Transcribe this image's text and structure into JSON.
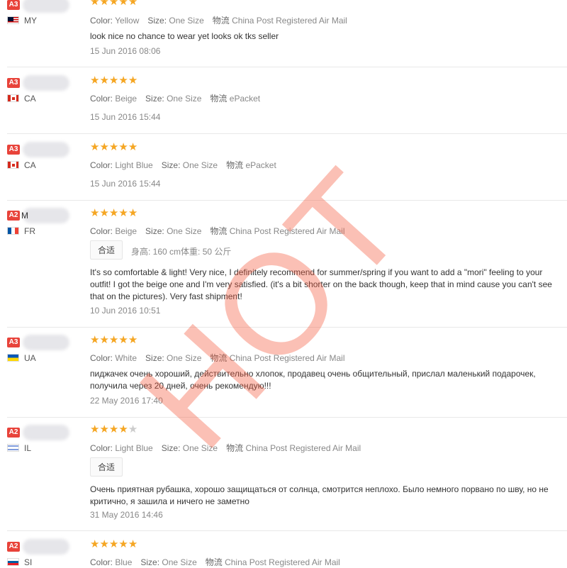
{
  "labels": {
    "color": "Color:",
    "size": "Size:",
    "shipping": "物流",
    "fit": "合适",
    "height": "身高:",
    "weight": "体重:"
  },
  "reviews": [
    {
      "level": "A3",
      "name": "",
      "country_code": "MY",
      "rating": 5,
      "color": "Yellow",
      "size": "One Size",
      "shipping": "China Post Registered Air Mail",
      "text": [
        "look nice no chance to wear yet looks ok tks seller"
      ],
      "date": "15 Jun 2016 08:06"
    },
    {
      "level": "A3",
      "name": "",
      "country_code": "CA",
      "rating": 5,
      "color": "Beige",
      "size": "One Size",
      "shipping": "ePacket",
      "text": [],
      "date": "15 Jun 2016 15:44"
    },
    {
      "level": "A3",
      "name": "",
      "country_code": "CA",
      "rating": 5,
      "color": "Light Blue",
      "size": "One Size",
      "shipping": "ePacket",
      "text": [],
      "date": "15 Jun 2016 15:44"
    },
    {
      "level": "A2",
      "name": "M",
      "country_code": "FR",
      "rating": 5,
      "color": "Beige",
      "size": "One Size",
      "shipping": "China Post Registered Air Mail",
      "height": "160 cm",
      "weight": "50 公斤",
      "text": [
        "It's so comfortable & light! Very nice, I definitely recommend for summer/spring if you want to add a \"mori\" feeling to your",
        "outfit! I got the beige one and I'm very satisfied. (it's a bit shorter on the back though, keep that in mind cause you can't see",
        "that on the pictures). Very fast shipment!"
      ],
      "date": "10 Jun 2016 10:51"
    },
    {
      "level": "A3",
      "name": "",
      "country_code": "UA",
      "rating": 5,
      "color": "White",
      "size": "One Size",
      "shipping": "China Post Registered Air Mail",
      "text": [
        "пиджачек очень хороший, действительно хлопок, продавец очень общительный, прислал маленький подарочек,",
        "получила через 20 дней, очень рекомендую!!!"
      ],
      "date": "22 May 2016 17:40"
    },
    {
      "level": "A2",
      "name": "",
      "country_code": "IL",
      "rating": 4,
      "color": "Light Blue",
      "size": "One Size",
      "shipping": "China Post Registered Air Mail",
      "text": [
        "Очень приятная рубашка, хорошо защищаться от солнца, смотрится неплохо. Было немного порвано по шву, но не",
        "критично, я зашила и ничего не заметно"
      ],
      "date": "31 May 2016 14:46"
    },
    {
      "level": "A2",
      "name": "",
      "country_code": "SI",
      "rating": 5,
      "color": "Blue",
      "size": "One Size",
      "shipping": "China Post Registered Air Mail",
      "text": [],
      "date": ""
    }
  ],
  "watermark": "HOT",
  "colors": {
    "level_badge": "#e8433a",
    "star": "#f5a623",
    "star_empty": "#cccccc",
    "watermark": "#f55a3c"
  }
}
